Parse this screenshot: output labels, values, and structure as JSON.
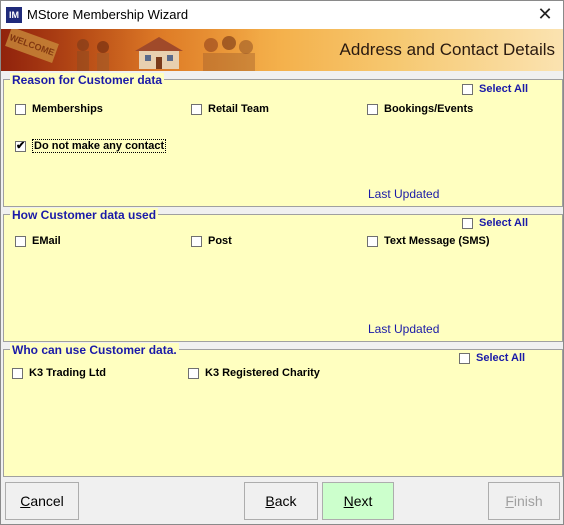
{
  "window": {
    "title": "MStore Membership Wizard",
    "app_icon_text": "IM"
  },
  "banner": {
    "title": "Address and Contact Details",
    "sign_text": "WELCOME"
  },
  "sections": {
    "reason": {
      "title": "Reason for Customer data",
      "select_all": "Select All",
      "options": [
        "Memberships",
        "Retail Team",
        "Bookings/Events"
      ],
      "no_contact": "Do not make any contact",
      "no_contact_checked": true,
      "last_updated": "Last Updated"
    },
    "used": {
      "title": "How Customer data used",
      "select_all": "Select All",
      "options": [
        "EMail",
        "Post",
        "Text Message (SMS)"
      ],
      "last_updated": "Last Updated"
    },
    "who": {
      "title": "Who can use Customer data.",
      "select_all": "Select All",
      "options": [
        "K3 Trading Ltd",
        "K3 Registered Charity"
      ]
    }
  },
  "buttons": {
    "cancel": {
      "first": "C",
      "rest": "ancel"
    },
    "back": {
      "first": "B",
      "rest": "ack"
    },
    "next": {
      "first": "N",
      "rest": "ext"
    },
    "finish": {
      "first": "F",
      "rest": "inish"
    }
  },
  "colors": {
    "section_bg": "#ffffc0",
    "label_blue": "#1a1aa8",
    "next_bg": "#ccffcc"
  }
}
